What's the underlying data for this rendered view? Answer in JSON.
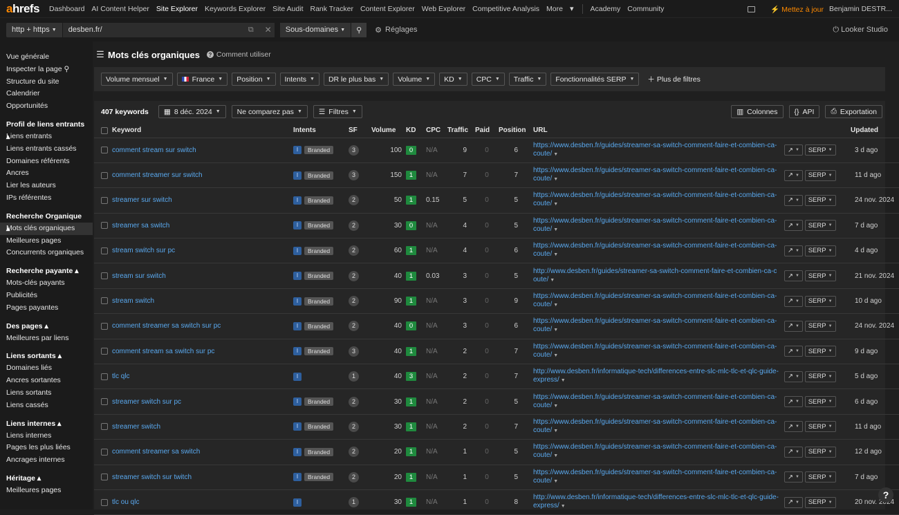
{
  "app": {
    "logo_a": "a",
    "logo_rest": "hrefs"
  },
  "topnav": [
    "Dashboard",
    "AI Content Helper",
    "Site Explorer",
    "Keywords Explorer",
    "Site Audit",
    "Rank Tracker",
    "Content Explorer",
    "Web Explorer",
    "Competitive Analysis",
    "More"
  ],
  "topnav_active": "Site Explorer",
  "topnav_extra": [
    "Academy",
    "Community"
  ],
  "topright": {
    "upgrade": "Mettez à jour",
    "user": "Benjamin DESTR..."
  },
  "urlbar": {
    "protocol": "http + https",
    "url": "desben.fr/",
    "mode": "Sous-domaines",
    "settings": "Réglages",
    "looker": "Looker Studio"
  },
  "sidebar": [
    {
      "type": "item",
      "label": "Vue générale"
    },
    {
      "type": "item",
      "label": "Inspecter la page"
    },
    {
      "type": "item",
      "label": "Structure du site"
    },
    {
      "type": "item",
      "label": "Calendrier"
    },
    {
      "type": "item",
      "label": "Opportunités"
    },
    {
      "type": "header",
      "label": "Profil de liens entrants"
    },
    {
      "type": "item",
      "label": "Liens entrants"
    },
    {
      "type": "item",
      "label": "Liens entrants cassés"
    },
    {
      "type": "item",
      "label": "Domaines référents"
    },
    {
      "type": "item",
      "label": "Ancres"
    },
    {
      "type": "item",
      "label": "Lier les auteurs"
    },
    {
      "type": "item",
      "label": "IPs référentes"
    },
    {
      "type": "header",
      "label": "Recherche Organique"
    },
    {
      "type": "item",
      "label": "Mots clés organiques",
      "active": true
    },
    {
      "type": "item",
      "label": "Meilleures pages"
    },
    {
      "type": "item",
      "label": "Concurrents organiques"
    },
    {
      "type": "header",
      "label": "Recherche payante"
    },
    {
      "type": "item",
      "label": "Mots-clés payants"
    },
    {
      "type": "item",
      "label": "Publicités"
    },
    {
      "type": "item",
      "label": "Pages payantes"
    },
    {
      "type": "header",
      "label": "Des pages"
    },
    {
      "type": "item",
      "label": "Meilleures par liens"
    },
    {
      "type": "header",
      "label": "Liens sortants"
    },
    {
      "type": "item",
      "label": "Domaines liés"
    },
    {
      "type": "item",
      "label": "Ancres sortantes"
    },
    {
      "type": "item",
      "label": "Liens sortants"
    },
    {
      "type": "item",
      "label": "Liens cassés"
    },
    {
      "type": "header",
      "label": "Liens internes"
    },
    {
      "type": "item",
      "label": "Liens internes"
    },
    {
      "type": "item",
      "label": "Pages les plus liées"
    },
    {
      "type": "item",
      "label": "Ancrages internes"
    },
    {
      "type": "header",
      "label": "Héritage"
    },
    {
      "type": "item",
      "label": "Meilleures pages"
    }
  ],
  "page": {
    "title": "Mots clés organiques",
    "howto": "Comment utiliser"
  },
  "filters": [
    "Volume mensuel",
    "France",
    "Position",
    "Intents",
    "DR le plus bas",
    "Volume",
    "KD",
    "CPC",
    "Traffic",
    "Fonctionnalités SERP"
  ],
  "more_filters": "Plus de filtres",
  "toolbar": {
    "count": "407 keywords",
    "date": "8 déc. 2024",
    "compare": "Ne comparez pas",
    "filters": "Filtres",
    "columns": "Colonnes",
    "api": "API",
    "export": "Exportation"
  },
  "columns": {
    "keyword": "Keyword",
    "intents": "Intents",
    "sf": "SF",
    "volume": "Volume",
    "kd": "KD",
    "cpc": "CPC",
    "traffic": "Traffic",
    "paid": "Paid",
    "position": "Position",
    "url": "URL",
    "updated": "Updated"
  },
  "intent_letter": "I",
  "branded_label": "Branded",
  "serp_label": "SERP",
  "rows": [
    {
      "kw": "comment stream sur switch",
      "branded": true,
      "sf": "3",
      "volume": "100",
      "kd": "0",
      "cpc": "N/A",
      "traffic": "9",
      "paid": "0",
      "pos": "6",
      "url": "https://www.desben.fr/guides/streamer-sa-switch-comment-faire-et-combien-ca-coute/",
      "updated": "3 d ago"
    },
    {
      "kw": "comment streamer sur switch",
      "branded": true,
      "sf": "3",
      "volume": "150",
      "kd": "1",
      "cpc": "N/A",
      "traffic": "7",
      "paid": "0",
      "pos": "7",
      "url": "https://www.desben.fr/guides/streamer-sa-switch-comment-faire-et-combien-ca-coute/",
      "updated": "11 d ago"
    },
    {
      "kw": "streamer sur switch",
      "branded": true,
      "sf": "2",
      "volume": "50",
      "kd": "1",
      "cpc": "0.15",
      "traffic": "5",
      "paid": "0",
      "pos": "5",
      "url": "https://www.desben.fr/guides/streamer-sa-switch-comment-faire-et-combien-ca-coute/",
      "updated": "24 nov. 2024"
    },
    {
      "kw": "streamer sa switch",
      "branded": true,
      "sf": "2",
      "volume": "30",
      "kd": "0",
      "cpc": "N/A",
      "traffic": "4",
      "paid": "0",
      "pos": "5",
      "url": "https://www.desben.fr/guides/streamer-sa-switch-comment-faire-et-combien-ca-coute/",
      "updated": "7 d ago"
    },
    {
      "kw": "stream switch sur pc",
      "branded": true,
      "sf": "2",
      "volume": "60",
      "kd": "1",
      "cpc": "N/A",
      "traffic": "4",
      "paid": "0",
      "pos": "6",
      "url": "https://www.desben.fr/guides/streamer-sa-switch-comment-faire-et-combien-ca-coute/",
      "updated": "4 d ago"
    },
    {
      "kw": "stream sur switch",
      "branded": true,
      "sf": "2",
      "volume": "40",
      "kd": "1",
      "cpc": "0.03",
      "traffic": "3",
      "paid": "0",
      "pos": "5",
      "url": "http://www.desben.fr/guides/streamer-sa-switch-comment-faire-et-combien-ca-coute/",
      "updated": "21 nov. 2024"
    },
    {
      "kw": "stream switch",
      "branded": true,
      "sf": "2",
      "volume": "90",
      "kd": "1",
      "cpc": "N/A",
      "traffic": "3",
      "paid": "0",
      "pos": "9",
      "url": "https://www.desben.fr/guides/streamer-sa-switch-comment-faire-et-combien-ca-coute/",
      "updated": "10 d ago"
    },
    {
      "kw": "comment streamer sa switch sur pc",
      "branded": true,
      "sf": "2",
      "volume": "40",
      "kd": "0",
      "cpc": "N/A",
      "traffic": "3",
      "paid": "0",
      "pos": "6",
      "url": "https://www.desben.fr/guides/streamer-sa-switch-comment-faire-et-combien-ca-coute/",
      "updated": "24 nov. 2024"
    },
    {
      "kw": "comment stream sa switch sur pc",
      "branded": true,
      "sf": "3",
      "volume": "40",
      "kd": "1",
      "cpc": "N/A",
      "traffic": "2",
      "paid": "0",
      "pos": "7",
      "url": "https://www.desben.fr/guides/streamer-sa-switch-comment-faire-et-combien-ca-coute/",
      "updated": "9 d ago"
    },
    {
      "kw": "tlc qlc",
      "branded": false,
      "sf": "1",
      "volume": "40",
      "kd": "3",
      "cpc": "N/A",
      "traffic": "2",
      "paid": "0",
      "pos": "7",
      "url": "http://www.desben.fr/informatique-tech/differences-entre-slc-mlc-tlc-et-qlc-guide-express/",
      "updated": "5 d ago"
    },
    {
      "kw": "streamer switch sur pc",
      "branded": true,
      "sf": "2",
      "volume": "30",
      "kd": "1",
      "cpc": "N/A",
      "traffic": "2",
      "paid": "0",
      "pos": "5",
      "url": "https://www.desben.fr/guides/streamer-sa-switch-comment-faire-et-combien-ca-coute/",
      "updated": "6 d ago"
    },
    {
      "kw": "streamer switch",
      "branded": true,
      "sf": "2",
      "volume": "30",
      "kd": "1",
      "cpc": "N/A",
      "traffic": "2",
      "paid": "0",
      "pos": "7",
      "url": "https://www.desben.fr/guides/streamer-sa-switch-comment-faire-et-combien-ca-coute/",
      "updated": "11 d ago"
    },
    {
      "kw": "comment streamer sa switch",
      "branded": true,
      "sf": "2",
      "volume": "20",
      "kd": "1",
      "cpc": "N/A",
      "traffic": "1",
      "paid": "0",
      "pos": "5",
      "url": "https://www.desben.fr/guides/streamer-sa-switch-comment-faire-et-combien-ca-coute/",
      "updated": "12 d ago"
    },
    {
      "kw": "streamer switch sur twitch",
      "branded": true,
      "sf": "2",
      "volume": "20",
      "kd": "1",
      "cpc": "N/A",
      "traffic": "1",
      "paid": "0",
      "pos": "5",
      "url": "https://www.desben.fr/guides/streamer-sa-switch-comment-faire-et-combien-ca-coute/",
      "updated": "7 d ago"
    },
    {
      "kw": "tlc ou qlc",
      "branded": false,
      "sf": "1",
      "volume": "30",
      "kd": "1",
      "cpc": "N/A",
      "traffic": "1",
      "paid": "0",
      "pos": "8",
      "url": "http://www.desben.fr/informatique-tech/differences-entre-slc-mlc-tlc-et-qlc-guide-express/",
      "updated": "20 nov. 2024"
    }
  ],
  "help": "?"
}
